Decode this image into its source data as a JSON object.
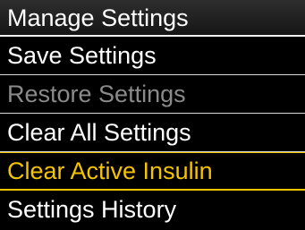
{
  "header": {
    "title": "Manage Settings"
  },
  "menu": {
    "items": [
      {
        "label": "Save Settings",
        "state": "normal"
      },
      {
        "label": "Restore Settings",
        "state": "disabled"
      },
      {
        "label": "Clear All Settings",
        "state": "normal"
      },
      {
        "label": "Clear Active Insulin",
        "state": "selected"
      },
      {
        "label": "Settings History",
        "state": "normal"
      }
    ]
  },
  "colors": {
    "background": "#000000",
    "text": "#ffffff",
    "disabled_text": "#8a8a8a",
    "selected": "#f5c400",
    "divider": "#d8d8d8"
  }
}
